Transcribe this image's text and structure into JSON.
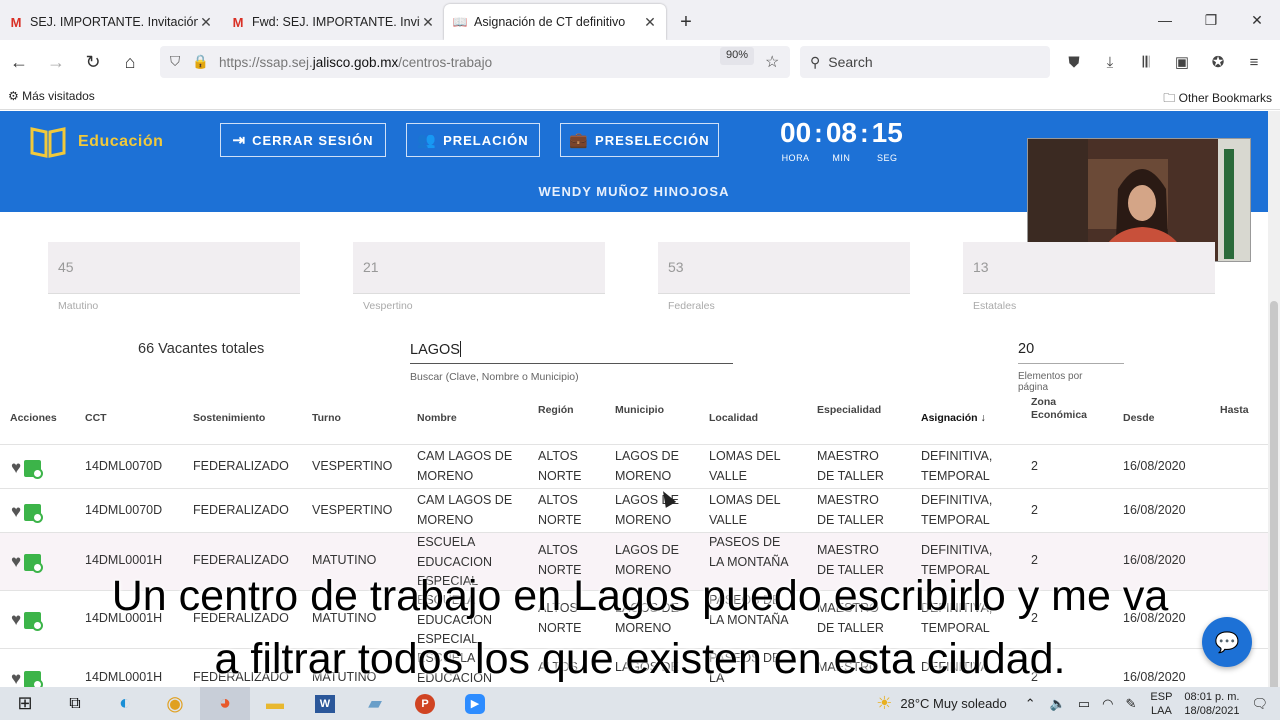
{
  "browser": {
    "tabs": [
      {
        "title": "SEJ. IMPORTANTE. Invitación, e",
        "icon": "gmail-icon"
      },
      {
        "title": "Fwd: SEJ. IMPORTANTE. Invitaci",
        "icon": "gmail-icon"
      },
      {
        "title": "Asignación de CT definitivo",
        "icon": "book-icon"
      }
    ],
    "url_prefix": "https://ssap.sej.",
    "url_domain": "jalisco.gob.mx",
    "url_path": "/centros-trabajo",
    "zoom": "90%",
    "search_placeholder": "Search",
    "bookmark_left": "Más visitados",
    "bookmark_right": "Other Bookmarks"
  },
  "header": {
    "logo_text": "Educación",
    "logout_label": "CERRAR SESIÓN",
    "prelacion_label": "PRELACIÓN",
    "preseleccion_label": "PRESELECCIÓN",
    "timer": {
      "hours": "00",
      "minutes": "08",
      "seconds": "15",
      "hours_label": "HORA",
      "minutes_label": "MIN",
      "seconds_label": "SEG"
    },
    "user_name": "WENDY MUÑOZ HINOJOSA"
  },
  "stats": [
    {
      "value": "45",
      "label": "Matutino"
    },
    {
      "value": "21",
      "label": "Vespertino"
    },
    {
      "value": "53",
      "label": "Federales"
    },
    {
      "value": "13",
      "label": "Estatales"
    }
  ],
  "filters": {
    "total_label": "66 Vacantes totales",
    "search_value": "LAGOS",
    "search_help": "Buscar (Clave, Nombre o Municipio)",
    "per_page_value": "20",
    "per_page_label": "Elementos por página"
  },
  "table": {
    "headers": {
      "acciones": "Acciones",
      "cct": "CCT",
      "sostenimiento": "Sostenimiento",
      "turno": "Turno",
      "nombre": "Nombre",
      "region": "Región",
      "municipio": "Municipio",
      "localidad": "Localidad",
      "especialidad": "Especialidad",
      "asignacion": "Asignación ↓",
      "zona": "Zona Económica",
      "desde": "Desde",
      "hasta": "Hasta"
    },
    "rows": [
      {
        "cct": "14DML0070D",
        "sostenimiento": "FEDERALIZADO",
        "turno": "VESPERTINO",
        "nombre": "CAM LAGOS DE MORENO",
        "region": "ALTOS NORTE",
        "municipio": "LAGOS DE MORENO",
        "localidad": "LOMAS DEL VALLE",
        "especialidad": "MAESTRO DE TALLER",
        "asignacion": "DEFINITIVA, TEMPORAL",
        "zona": "2",
        "desde": "16/08/2020",
        "hasta": ""
      },
      {
        "cct": "14DML0070D",
        "sostenimiento": "FEDERALIZADO",
        "turno": "VESPERTINO",
        "nombre": "CAM LAGOS DE MORENO",
        "region": "ALTOS NORTE",
        "municipio": "LAGOS DE MORENO",
        "localidad": "LOMAS DEL VALLE",
        "especialidad": "MAESTRO DE TALLER",
        "asignacion": "DEFINITIVA, TEMPORAL",
        "zona": "2",
        "desde": "16/08/2020",
        "hasta": ""
      },
      {
        "cct": "14DML0001H",
        "sostenimiento": "FEDERALIZADO",
        "turno": "MATUTINO",
        "nombre": "ESCUELA EDUCACION ESPECIAL",
        "region": "ALTOS NORTE",
        "municipio": "LAGOS DE MORENO",
        "localidad": "PASEOS DE LA MONTAÑA",
        "especialidad": "MAESTRO DE TALLER",
        "asignacion": "DEFINITIVA, TEMPORAL",
        "zona": "2",
        "desde": "16/08/2020",
        "hasta": ""
      },
      {
        "cct": "14DML0001H",
        "sostenimiento": "FEDERALIZADO",
        "turno": "MATUTINO",
        "nombre": "ESCUELA EDUCACION ESPECIAL",
        "region": "ALTOS NORTE",
        "municipio": "LAGOS DE MORENO",
        "localidad": "PASEOS DE LA MONTAÑA",
        "especialidad": "MAESTRO DE TALLER",
        "asignacion": "DEFINITIVA, TEMPORAL",
        "zona": "2",
        "desde": "16/08/2020",
        "hasta": ""
      },
      {
        "cct": "14DML0001H",
        "sostenimiento": "FEDERALIZADO",
        "turno": "MATUTINO",
        "nombre": "ESCUELA EDUCACION",
        "region": "ALTOS",
        "municipio": "LAGOS DE",
        "localidad": "PASEOS DE LA",
        "especialidad": "MAESTRO",
        "asignacion": "DEFINITIVA,",
        "zona": "2",
        "desde": "16/08/2020",
        "hasta": ""
      }
    ]
  },
  "subtitles": {
    "line1": "Un centro de trabajo en Lagos  puedo escribirlo y me va",
    "line2": "a filtrar todos los que existen en esta ciudad."
  },
  "taskbar": {
    "weather": "28°C  Muy soleado",
    "lang_top": "ESP",
    "lang_bottom": "LAA",
    "time": "08:01 p. m.",
    "date": "18/08/2021"
  }
}
